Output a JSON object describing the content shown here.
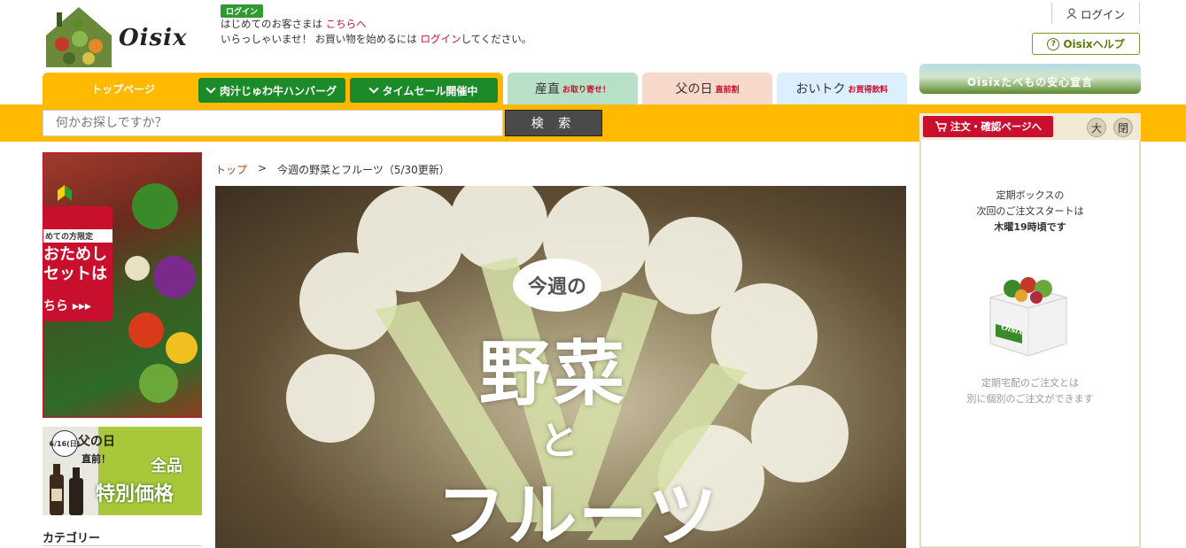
{
  "header": {
    "logo_text": "Oisix",
    "login_badge": "ログイン",
    "greeting_line1_prefix": "はじめてのお客さまは ",
    "greeting_line1_link": "こちらへ",
    "greeting_line2_prefix": "いらっしゃいませ！ お買い物を始めるには ",
    "greeting_line2_link": "ログイン",
    "greeting_line2_suffix": "してください。",
    "top_login": "ログイン",
    "help_button": "Oisixヘルプ"
  },
  "nav": {
    "top_page": "トップページ",
    "green_buttons": [
      "肉汁じゅわ牛ハンバーグ",
      "タイムセール開催中"
    ],
    "tabs": [
      {
        "label": "産直",
        "sub": "お取り寄せ！",
        "color": "#b7e0c6"
      },
      {
        "label": "父の日",
        "sub": "直前割",
        "color": "#f7d9cc"
      },
      {
        "label": "おいトク",
        "sub": "お買得飲料",
        "color": "#dcefff"
      }
    ],
    "banner_anzen": "Oisixたべもの安心宣言"
  },
  "search": {
    "placeholder": "何かお探しですか？",
    "button": "検 索"
  },
  "sidebar_right": {
    "order_button": "注文・確認ページへ",
    "size_large": "大",
    "close": "閉",
    "line1": "定期ボックスの",
    "line2": "次回のご注文スタートは",
    "line3": "木曜19時頃です",
    "box_label": "Oisix",
    "note1": "定期宅配のご注文とは",
    "note2": "別に個別のご注文ができます"
  },
  "sidebar_left": {
    "promo1_strip": "めての方限定",
    "promo1_big": "おためしセットは",
    "promo1_cta": "ちら ▸▸▸",
    "promo2_date": "6/16(日)",
    "promo2_line1": "父の日",
    "promo2_line2": "直前！",
    "promo2_line3": "全品",
    "promo2_line4": "特別価格",
    "category_label": "カテゴリー"
  },
  "main": {
    "breadcrumb_home": "トップ",
    "breadcrumb_sep": ">",
    "breadcrumb_current": "今週の野菜とフルーツ（5/30更新）",
    "hero_bubble": "今週の",
    "hero_title1": "野菜",
    "hero_title2": "と",
    "hero_title3": "フルーツ"
  },
  "colors": {
    "accent_yellow": "#ffb900",
    "brand_red": "#c8102e",
    "green": "#1d8a2a"
  }
}
